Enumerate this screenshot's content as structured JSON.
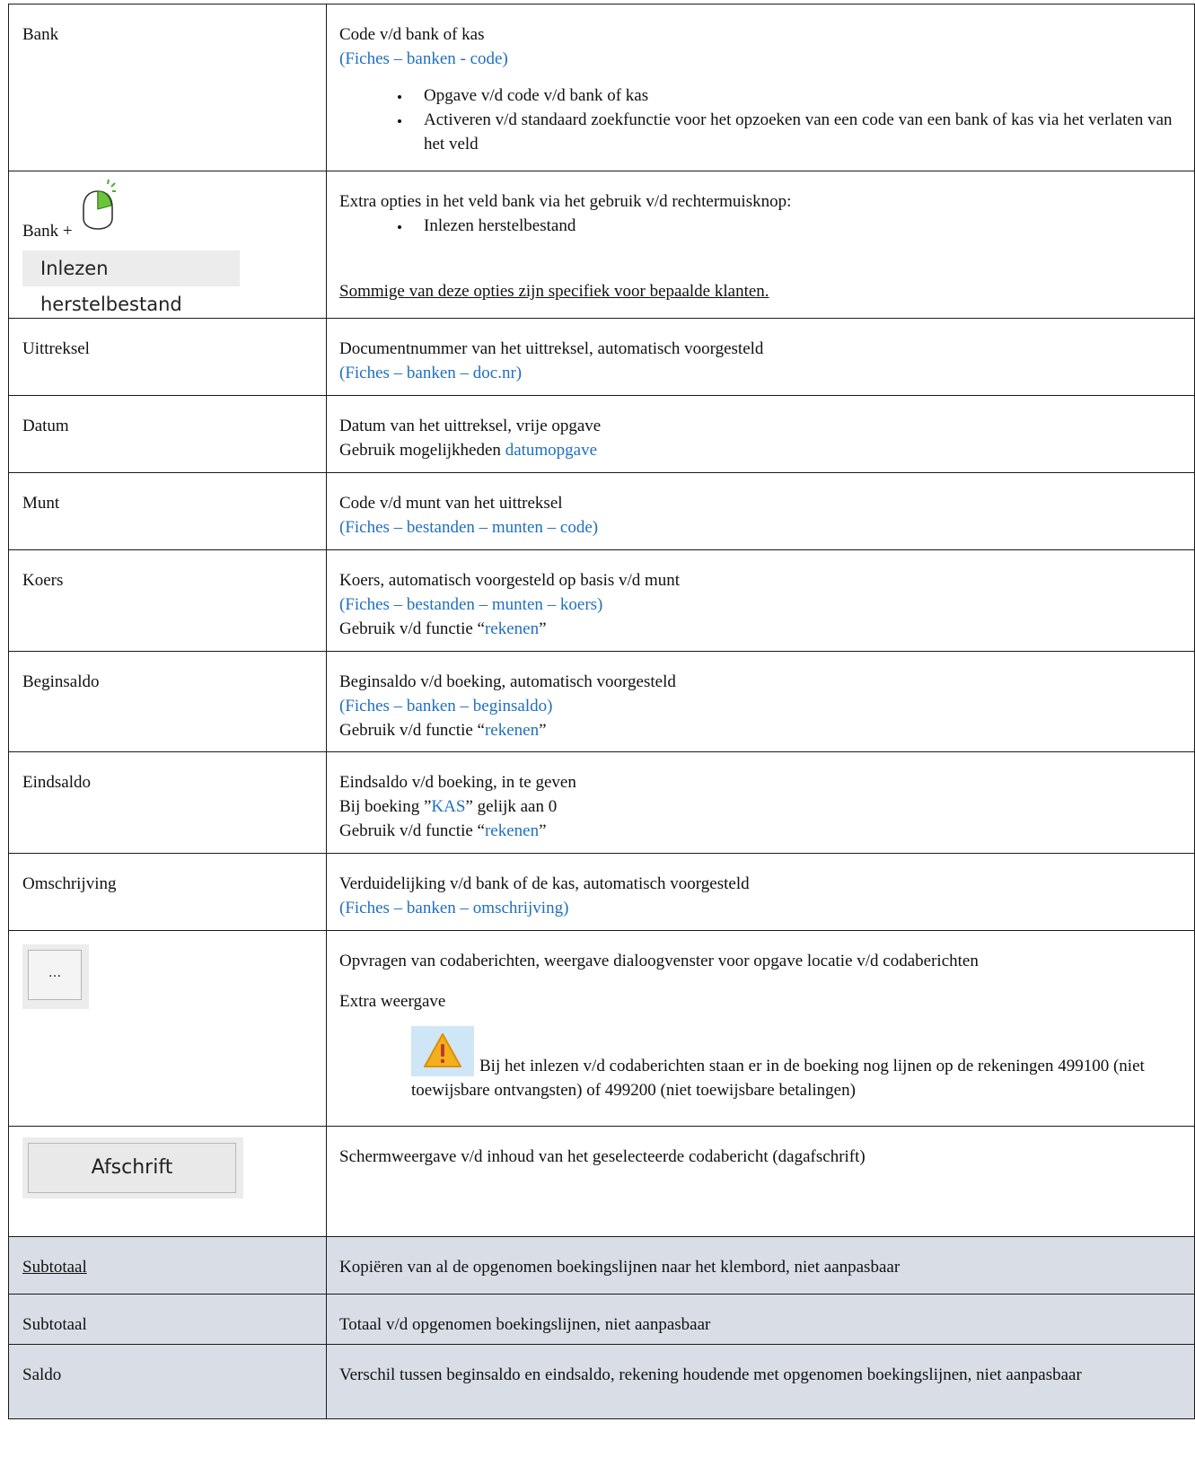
{
  "rows": {
    "bank": {
      "label": "Bank",
      "title": "Code v/d bank of kas",
      "ref": "(Fiches – banken - code)",
      "bullets": [
        "Opgave v/d code v/d bank of kas",
        "Activeren v/d standaard zoekfunctie voor het opzoeken van een code van een bank of kas via het verlaten van het veld"
      ]
    },
    "bank_mouse": {
      "label": "Bank +",
      "button_label": "Inlezen herstelbestand",
      "intro": "Extra opties in het veld bank via het gebruik v/d rechtermuisknop:",
      "bullets": [
        "Inlezen herstelbestand"
      ],
      "note": "Sommige van deze opties zijn specifiek voor bepaalde klanten."
    },
    "uittreksel": {
      "label": "Uittreksel",
      "line1": "Documentnummer van het uittreksel, automatisch voorgesteld",
      "ref": "(Fiches – banken – doc.nr)"
    },
    "datum": {
      "label": "Datum",
      "line1": "Datum van het uittreksel, vrije opgave",
      "line2_prefix": "Gebruik mogelijkheden ",
      "line2_link": "datumopgave"
    },
    "munt": {
      "label": "Munt",
      "line1": "Code v/d munt van het uittreksel",
      "ref": "(Fiches – bestanden – munten – code)"
    },
    "koers": {
      "label": "Koers",
      "line1": "Koers, automatisch voorgesteld op basis v/d munt",
      "ref": "(Fiches – bestanden – munten – koers)",
      "func_prefix": "Gebruik v/d functie “",
      "func_link": "rekenen",
      "func_suffix": "”"
    },
    "beginsaldo": {
      "label": "Beginsaldo",
      "line1": "Beginsaldo v/d boeking, automatisch voorgesteld",
      "ref": "(Fiches – banken – beginsaldo)",
      "func_prefix": "Gebruik v/d functie “",
      "func_link": "rekenen",
      "func_suffix": "”"
    },
    "eindsaldo": {
      "label": "Eindsaldo",
      "line1": "Eindsaldo v/d boeking, in te geven",
      "kas_prefix": "Bij boeking ”",
      "kas_link": "KAS",
      "kas_suffix": "” gelijk aan 0",
      "func_prefix": "Gebruik v/d functie “",
      "func_link": "rekenen",
      "func_suffix": "”"
    },
    "omschrijving": {
      "label": "Omschrijving",
      "line1": "Verduidelijking v/d bank of de kas, automatisch voorgesteld",
      "ref": "(Fiches – banken – omschrijving)"
    },
    "coda": {
      "button_label": "...",
      "line1": "Opvragen van codaberichten, weergave dialoogvenster voor opgave locatie v/d codaberichten",
      "extra": "Extra weergave",
      "warning": "Bij het inlezen v/d codaberichten staan er in de boeking nog lijnen op de rekeningen 499100 (niet toewijsbare ontvangsten) of 499200 (niet toewijsbare betalingen)"
    },
    "afschrift": {
      "button_label": "Afschrift",
      "line1": "Schermweergave v/d inhoud van het geselecteerde codabericht (dagafschrift)"
    },
    "subtotaal_link": {
      "label": "Subtotaal",
      "line1": "Kopiëren van al de opgenomen boekingslijnen naar het klembord, niet aanpasbaar"
    },
    "subtotaal": {
      "label": "Subtotaal",
      "line1": "Totaal v/d opgenomen boekingslijnen, niet aanpasbaar"
    },
    "saldo": {
      "label": "Saldo",
      "line1": "Verschil tussen beginsaldo en eindsaldo, rekening houdende met opgenomen boekingslijnen, niet aanpasbaar"
    }
  },
  "colors": {
    "link": "#1f6fbf",
    "shaded_row": "#d9dee6",
    "warning_bg": "#cfe6f7",
    "warning_fill": "#f2b01e"
  },
  "icons": {
    "mouse": "mouse-right-click-icon",
    "warning": "warning-icon"
  }
}
